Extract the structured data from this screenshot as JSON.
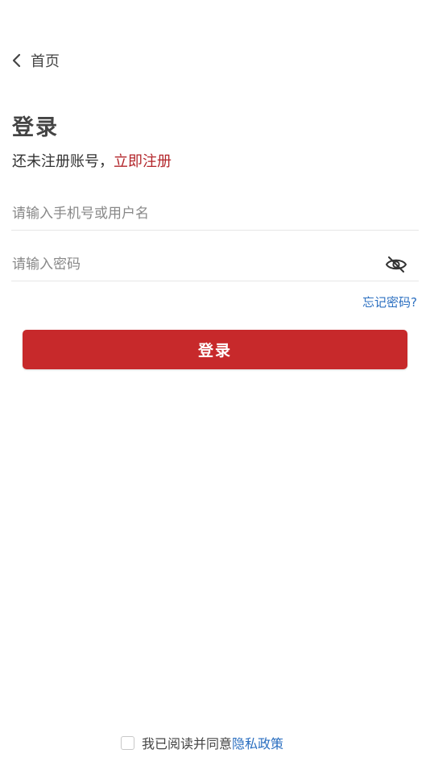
{
  "nav": {
    "back_label": "首页",
    "back_icon": "chevron-left-icon"
  },
  "login": {
    "title": "登录",
    "register_prompt": "还未注册账号，",
    "register_link": "立即注册",
    "username_placeholder": "请输入手机号或用户名",
    "username_value": "",
    "password_placeholder": "请输入密码",
    "password_value": "",
    "password_toggle_icon": "eye-off-icon",
    "forgot_password": "忘记密码?",
    "submit_label": "登录"
  },
  "agreement": {
    "checked": false,
    "text": "我已阅读并同意",
    "privacy_link": "隐私政策"
  },
  "colors": {
    "accent": "#c7292b",
    "link": "#2b6fc0",
    "register_link": "#b3262b"
  }
}
